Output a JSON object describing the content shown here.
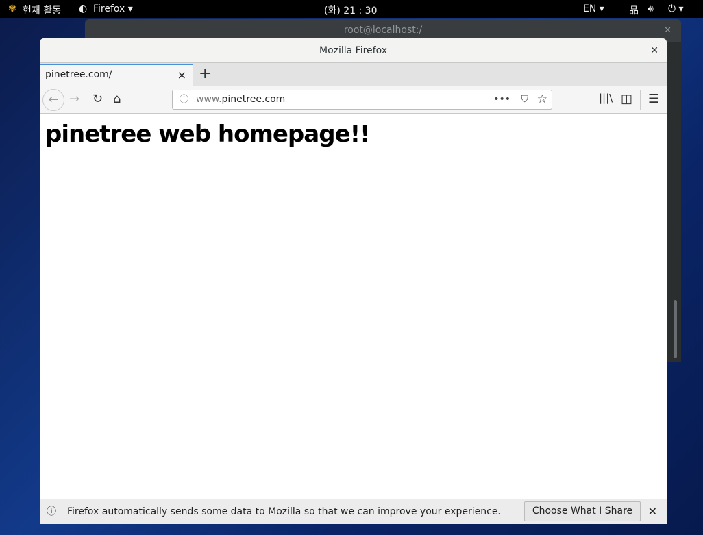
{
  "topbar": {
    "activities": "현재 활동",
    "app_menu": "Firefox ▾",
    "clock": "(화) 21 : 30",
    "lang": "EN ▾"
  },
  "terminal": {
    "title": "root@localhost:/"
  },
  "firefox": {
    "window_title": "Mozilla Firefox",
    "tab_title": "pinetree.com/",
    "url_prefix": "www.",
    "url_domain": "pinetree.com",
    "page_heading": "pinetree web homepage!!",
    "notice": {
      "message": "Firefox automatically sends some data to Mozilla so that we can improve your experience.",
      "button": "Choose What I Share"
    }
  },
  "colors": {
    "tab_accent": "#4a90d9",
    "topbar": "#000000"
  }
}
